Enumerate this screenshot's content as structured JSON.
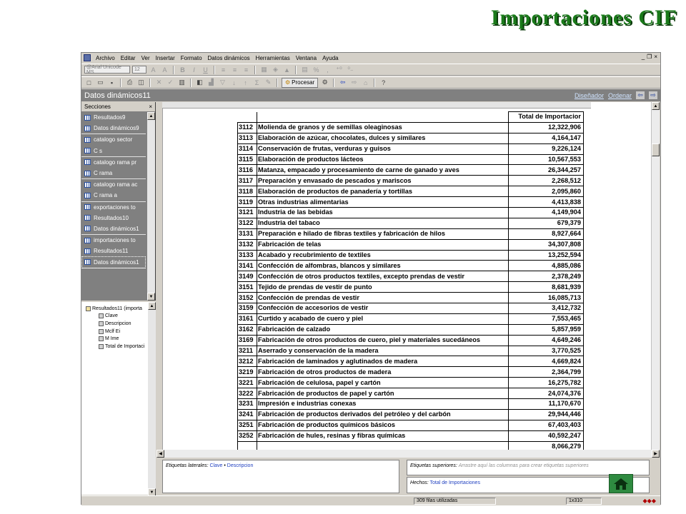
{
  "slide_title": "Importaciones CIF",
  "menu": [
    "Archivo",
    "Editar",
    "Ver",
    "Insertar",
    "Formato",
    "Datos dinámicos",
    "Herramientas",
    "Ventana",
    "Ayuda"
  ],
  "window_controls": [
    "_",
    "❐",
    "×"
  ],
  "toolbar": {
    "font_name": "@Arial Unicode MS",
    "font_size": "12",
    "grow_font": "A",
    "shrink_font": "A",
    "bold": "B",
    "italic": "I",
    "underline": "U",
    "percent": "%",
    "comma": ",",
    "process_label": "Procesar",
    "help": "?"
  },
  "pane": {
    "title": "Datos dinámicos11",
    "links": [
      "Diseñador",
      "Ordenar"
    ],
    "back_arrow": "⇦",
    "forward_arrow": "⇨"
  },
  "sections": {
    "header": "Secciones",
    "close": "×",
    "items": [
      {
        "label": "Resultados9"
      },
      {
        "label": "Datos dinámicos9"
      },
      {
        "label": "catalogo sector"
      },
      {
        "label": "C s"
      },
      {
        "label": "catalogo rama pr"
      },
      {
        "label": "C rama"
      },
      {
        "label": "catalogo rama ac"
      },
      {
        "label": "C rama a"
      },
      {
        "label": "exportaciones to"
      },
      {
        "label": "Resultados10"
      },
      {
        "label": "Datos dinámicos1"
      },
      {
        "label": "importaciones to"
      },
      {
        "label": "Resultados11"
      },
      {
        "label": "Datos dinámicos1"
      }
    ]
  },
  "tree": {
    "root": "Resultados11 (importa",
    "fields": [
      "Clave",
      "Descripcion",
      "Mclf Ei",
      "M Ime",
      "Total de Importaci"
    ]
  },
  "pivot": {
    "header_total": "Total de Importacior",
    "rows": [
      {
        "clave": "3112",
        "descripcion": "Molienda de granos y de semillas oleaginosas",
        "total": "12,322,906"
      },
      {
        "clave": "3113",
        "descripcion": "Elaboración de azúcar, chocolates, dulces y similares",
        "total": "4,164,147"
      },
      {
        "clave": "3114",
        "descripcion": "Conservación de frutas, verduras y guisos",
        "total": "9,226,124"
      },
      {
        "clave": "3115",
        "descripcion": "Elaboración de productos lácteos",
        "total": "10,567,553"
      },
      {
        "clave": "3116",
        "descripcion": "Matanza, empacado y procesamiento de carne de ganado y aves",
        "total": "26,344,257"
      },
      {
        "clave": "3117",
        "descripcion": "Preparación y envasado de pescados y mariscos",
        "total": "2,268,512"
      },
      {
        "clave": "3118",
        "descripcion": "Elaboración de productos de panadería y tortillas",
        "total": "2,095,860"
      },
      {
        "clave": "3119",
        "descripcion": "Otras industrias alimentarias",
        "total": "4,413,838"
      },
      {
        "clave": "3121",
        "descripcion": "Industria de las bebidas",
        "total": "4,149,904"
      },
      {
        "clave": "3122",
        "descripcion": "Industria del tabaco",
        "total": "679,379"
      },
      {
        "clave": "3131",
        "descripcion": "Preparación e hilado de fibras textiles y fabricación de hilos",
        "total": "8,927,664"
      },
      {
        "clave": "3132",
        "descripcion": "Fabricación de telas",
        "total": "34,307,808"
      },
      {
        "clave": "3133",
        "descripcion": "Acabado y recubrimiento de textiles",
        "total": "13,252,594"
      },
      {
        "clave": "3141",
        "descripcion": "Confección de alfombras, blancos y similares",
        "total": "4,885,086"
      },
      {
        "clave": "3149",
        "descripcion": "Confección de otros productos textiles, excepto prendas de vestir",
        "total": "2,378,249"
      },
      {
        "clave": "3151",
        "descripcion": "Tejido de prendas de vestir de punto",
        "total": "8,681,939"
      },
      {
        "clave": "3152",
        "descripcion": "Confección de prendas de vestir",
        "total": "16,085,713"
      },
      {
        "clave": "3159",
        "descripcion": "Confección de accesorios de vestir",
        "total": "3,412,732"
      },
      {
        "clave": "3161",
        "descripcion": "Curtido y acabado de cuero y piel",
        "total": "7,553,465"
      },
      {
        "clave": "3162",
        "descripcion": "Fabricación de calzado",
        "total": "5,857,959"
      },
      {
        "clave": "3169",
        "descripcion": "Fabricación de otros productos de cuero, piel y materiales sucedáneos",
        "total": "4,649,246"
      },
      {
        "clave": "3211",
        "descripcion": "Aserrado y conservación de la madera",
        "total": "3,770,525"
      },
      {
        "clave": "3212",
        "descripcion": "Fabricación de laminados y aglutinados de madera",
        "total": "4,669,824"
      },
      {
        "clave": "3219",
        "descripcion": "Fabricación de otros productos de madera",
        "total": "2,364,799"
      },
      {
        "clave": "3221",
        "descripcion": "Fabricación de celulosa, papel y cartón",
        "total": "16,275,782"
      },
      {
        "clave": "3222",
        "descripcion": "Fabricación de productos de papel y cartón",
        "total": "24,074,376"
      },
      {
        "clave": "3231",
        "descripcion": "Impresión e industrias conexas",
        "total": "11,170,670"
      },
      {
        "clave": "3241",
        "descripcion": "Fabricación de productos derivados del petróleo y del carbón",
        "total": "29,944,446"
      },
      {
        "clave": "3251",
        "descripcion": "Fabricación de productos químicos básicos",
        "total": "67,403,403"
      },
      {
        "clave": "3252",
        "descripcion": "Fabricación de hules, resinas y fibras químicas",
        "total": "40,592,247"
      },
      {
        "clave": "",
        "descripcion": "",
        "total": "8,066,279"
      }
    ]
  },
  "drop_zones": {
    "lateral_label": "Etiquetas laterales:",
    "lateral_fields": [
      "Clave",
      "Descripcion"
    ],
    "lateral_sep": "•",
    "superior_label": "Etiquetas superiores:",
    "superior_hint": "Arrastre aquí las columnas para crear etiquetas superiores",
    "hechos_label": "Hechos:",
    "hechos_value": "Total de Importaciones"
  },
  "status": {
    "rows_used": "309 filas utilizadas",
    "dimension": "1x310"
  },
  "colors": {
    "title_green": "#1a7a1a",
    "pane_gray": "#808080",
    "home_button": "#2e8a40"
  }
}
